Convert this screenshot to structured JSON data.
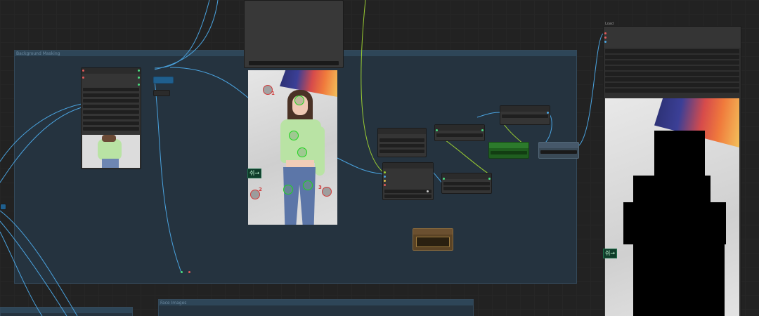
{
  "groups": {
    "background_masking": {
      "title": "Background Masking"
    },
    "face_images": {
      "title": "Face Images"
    }
  },
  "preview_node": {
    "title": "Load"
  },
  "photo": {
    "sign_text": "쉬→"
  },
  "colors": {
    "canvas": "#222222",
    "group_fill": "#25333f",
    "wire_blue": "#4aa3df",
    "wire_green": "#9acd32",
    "node_fill": "#353535",
    "positive_marker": "#1fd61f",
    "negative_marker": "#d03a3a",
    "bool_node_green": "#1f5e1f",
    "brown_node": "#5a4325"
  },
  "markers": {
    "negative_labels": [
      "1",
      "2",
      "3"
    ]
  }
}
